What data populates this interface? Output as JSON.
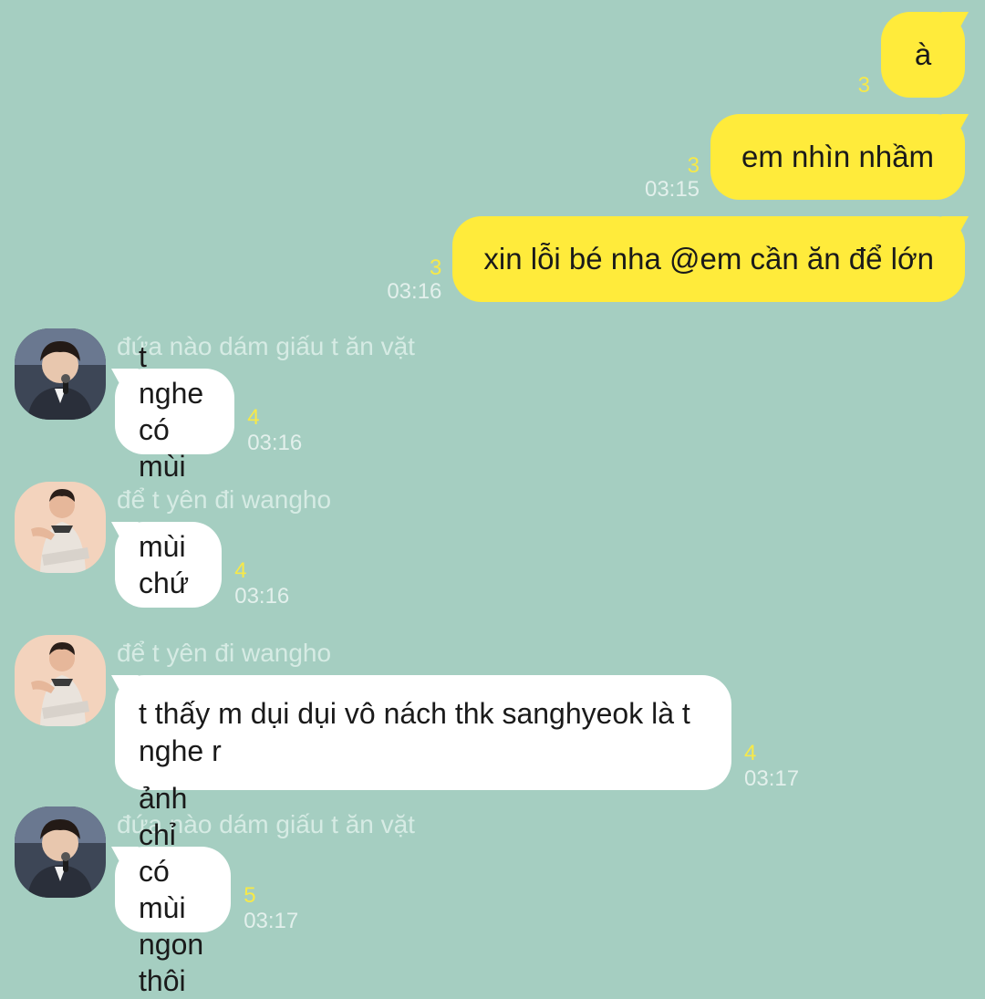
{
  "messages_out": [
    {
      "text": "à",
      "unread": "3",
      "time": ""
    },
    {
      "text": "em nhìn nhầm",
      "unread": "3",
      "time": "03:15"
    },
    {
      "text": "xin lỗi bé nha @em cần ăn để lớn",
      "unread": "3",
      "time": "03:16"
    }
  ],
  "messages_in": [
    {
      "sender": "đứa nào dám giấu t ăn vặt",
      "avatar": "avatar-boy-microphone",
      "text": "t nghe có mùi",
      "unread": "4",
      "time": "03:16"
    },
    {
      "sender": "để t yên đi wangho",
      "avatar": "avatar-boy-sitting",
      "text": "mùi chứ",
      "unread": "4",
      "time": "03:16"
    },
    {
      "sender": "để t yên đi wangho",
      "avatar": "avatar-boy-sitting",
      "text": "t thấy m dụi dụi vô nách thk sanghyeok là t nghe r",
      "unread": "4",
      "time": "03:17"
    },
    {
      "sender": "đứa nào dám giấu t ăn vặt",
      "avatar": "avatar-boy-microphone",
      "text": "ảnh chỉ có mùi ngon thôi",
      "unread": "5",
      "time": "03:17"
    }
  ],
  "colors": {
    "background": "#a5cec1",
    "outgoing_bubble": "#ffeb3b",
    "incoming_bubble": "#ffffff",
    "unread_count": "#f7e948",
    "timestamp": "#e3f0ec",
    "sender_name": "#d6ebe4"
  }
}
